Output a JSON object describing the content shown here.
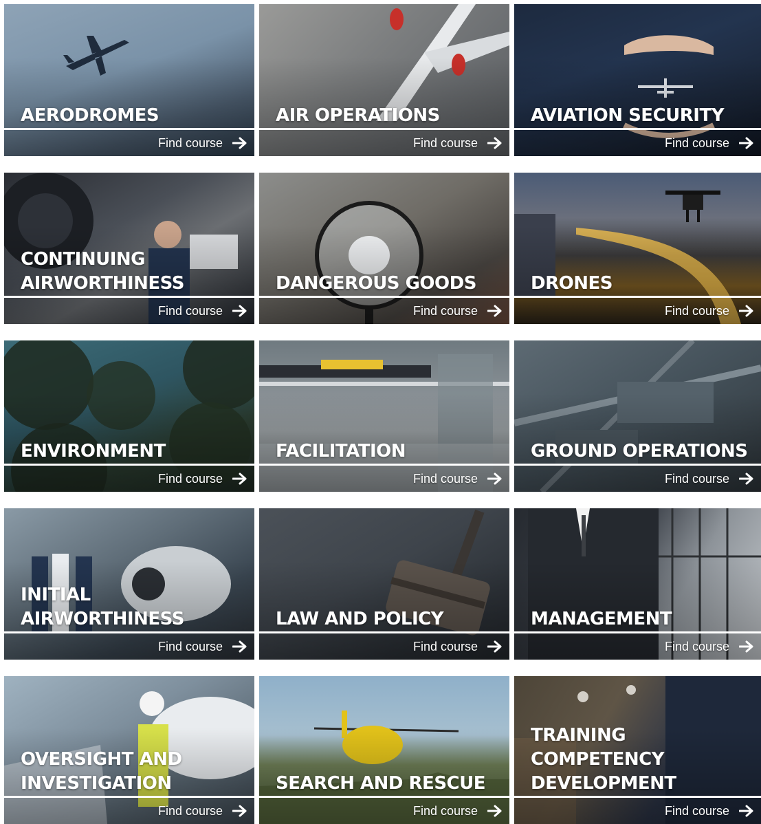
{
  "cards": [
    {
      "title_lines": [
        "AERODROMES"
      ],
      "cta": "Find course"
    },
    {
      "title_lines": [
        "AIR OPERATIONS"
      ],
      "cta": "Find course"
    },
    {
      "title_lines": [
        "AVIATION SECURITY"
      ],
      "cta": "Find course"
    },
    {
      "title_lines": [
        "CONTINUING",
        "AIRWORTHINESS"
      ],
      "cta": "Find course"
    },
    {
      "title_lines": [
        "DANGEROUS GOODS"
      ],
      "cta": "Find course"
    },
    {
      "title_lines": [
        "DRONES"
      ],
      "cta": "Find course"
    },
    {
      "title_lines": [
        "ENVIRONMENT"
      ],
      "cta": "Find course"
    },
    {
      "title_lines": [
        "FACILITATION"
      ],
      "cta": "Find course"
    },
    {
      "title_lines": [
        "GROUND OPERATIONS"
      ],
      "cta": "Find course"
    },
    {
      "title_lines": [
        "INITIAL",
        "AIRWORTHINESS"
      ],
      "cta": "Find course"
    },
    {
      "title_lines": [
        "LAW AND POLICY"
      ],
      "cta": "Find course"
    },
    {
      "title_lines": [
        "MANAGEMENT"
      ],
      "cta": "Find course"
    },
    {
      "title_lines": [
        "OVERSIGHT AND",
        "INVESTIGATION"
      ],
      "cta": "Find course"
    },
    {
      "title_lines": [
        "SEARCH AND RESCUE"
      ],
      "cta": "Find course"
    },
    {
      "title_lines": [
        "TRAINING",
        "COMPETENCY",
        "DEVELOPMENT"
      ],
      "cta": "Find course"
    }
  ],
  "icons": {
    "cta_arrow": "arrow-right-icon"
  },
  "colors": {
    "text": "#ffffff",
    "rule": "#ffffff",
    "page_background": "#ffffff"
  }
}
